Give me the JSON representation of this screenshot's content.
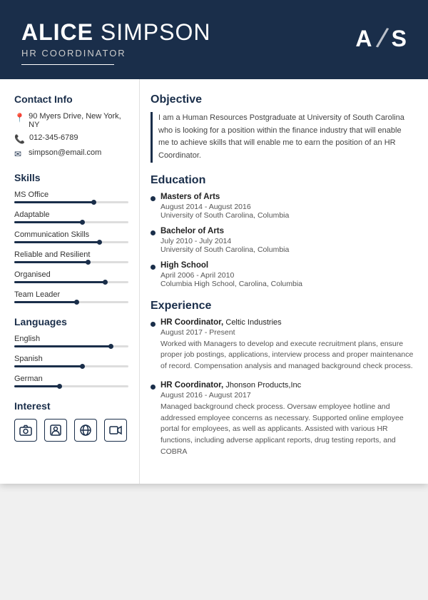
{
  "header": {
    "first_name": "ALICE",
    "last_name": " SIMPSON",
    "title": "HR COORDINATOR",
    "initial1": "A",
    "initial2": "S"
  },
  "contact": {
    "section_title": "Contact Info",
    "address": "90 Myers Drive, New York, NY",
    "phone": "012-345-6789",
    "email": "simpson@email.com"
  },
  "skills": {
    "section_title": "Skills",
    "items": [
      {
        "name": "MS Office",
        "pct": 70
      },
      {
        "name": "Adaptable",
        "pct": 60
      },
      {
        "name": "Communication Skills",
        "pct": 75
      },
      {
        "name": "Reliable and Resilient",
        "pct": 65
      },
      {
        "name": "Organised",
        "pct": 80
      },
      {
        "name": "Team Leader",
        "pct": 55
      }
    ]
  },
  "languages": {
    "section_title": "Languages",
    "items": [
      {
        "name": "English",
        "pct": 85
      },
      {
        "name": "Spanish",
        "pct": 60
      },
      {
        "name": "German",
        "pct": 40
      }
    ]
  },
  "interest": {
    "section_title": "Interest",
    "icons": [
      "📷",
      "👤",
      "🌐",
      "🎬"
    ]
  },
  "objective": {
    "section_title": "Objective",
    "text": "I am a Human Resources Postgraduate at University of South Carolina who is looking for a position within the finance industry that will enable me to achieve skills that will enable me to earn the position of an HR Coordinator."
  },
  "education": {
    "section_title": "Education",
    "items": [
      {
        "degree": "Masters of Arts",
        "date": "August 2014 - August 2016",
        "school": "University of South Carolina, Columbia"
      },
      {
        "degree": "Bachelor of Arts",
        "date": "July 2010 - July 2014",
        "school": "University of South Carolina, Columbia"
      },
      {
        "degree": "High School",
        "date": "April 2006 - April 2010",
        "school": "Columbia High School, Carolina, Columbia"
      }
    ]
  },
  "experience": {
    "section_title": "Experience",
    "items": [
      {
        "title": "HR Coordinator",
        "company": "Celtic Industries",
        "date": "August 2017 - Present",
        "desc": "Worked with Managers to develop and execute recruitment plans, ensure proper job postings, applications, interview process and proper maintenance of record. Compensation analysis and managed background check process."
      },
      {
        "title": "HR Coordinator",
        "company": "Jhonson Products,Inc",
        "date": "August 2016 - August 2017",
        "desc": "Managed background check process. Oversaw employee hotline and addressed employee concerns as necessary. Supported online employee portal for employees, as well as applicants. Assisted with various HR functions, including adverse applicant reports, drug testing reports, and COBRA"
      }
    ]
  }
}
